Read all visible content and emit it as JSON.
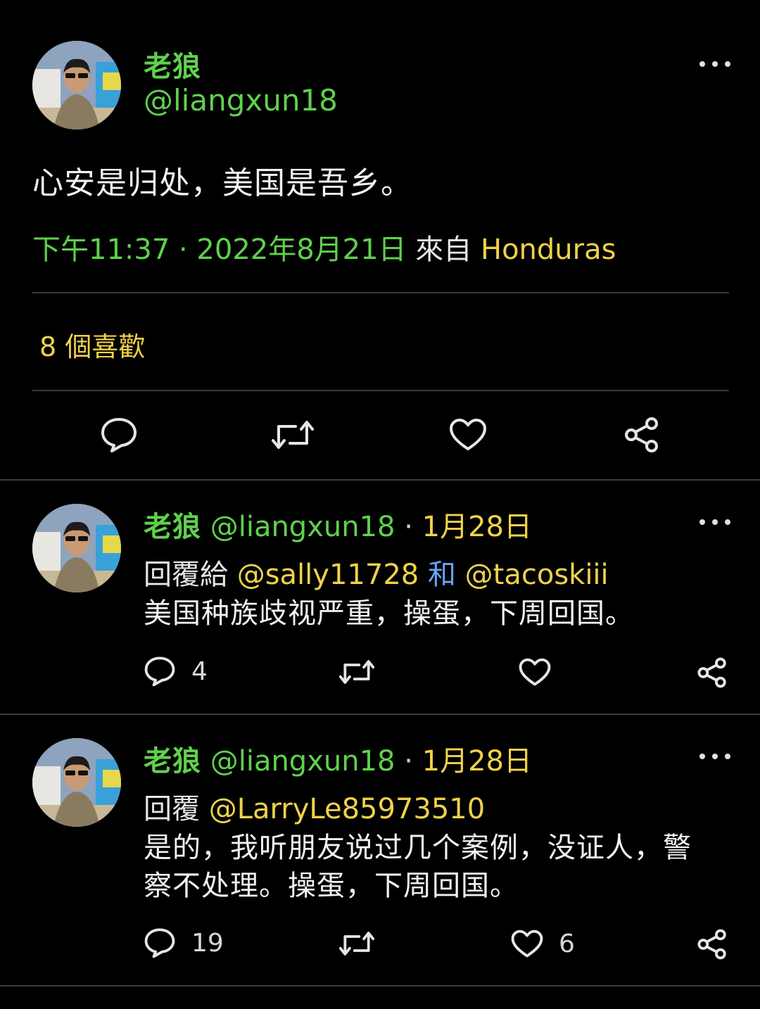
{
  "main_tweet": {
    "display_name": "老狼",
    "handle": "@liangxun18",
    "text": "心安是归处，美国是吾乡。",
    "time": "下午11:37 · 2022年8月21日",
    "source_prefix": "來自",
    "source_location": "Honduras",
    "likes_count": "8",
    "likes_label": "個喜歡",
    "icons": [
      "reply-icon",
      "retweet-icon",
      "like-icon",
      "share-icon",
      "more-icon"
    ]
  },
  "replies": [
    {
      "display_name": "老狼",
      "handle": "@liangxun18",
      "separator": "·",
      "date": "1月28日",
      "reply_label": "回覆給",
      "mention_1": "@sally11728",
      "conjunction": "和",
      "mention_2": "@tacoskiii",
      "text": "美国种族歧视严重，操蛋，下周回国。",
      "reply_count": "4",
      "retweet_count": "",
      "like_count": ""
    },
    {
      "display_name": "老狼",
      "handle": "@liangxun18",
      "separator": "·",
      "date": "1月28日",
      "reply_label": "回覆",
      "mention_1": "@LarryLe85973510",
      "text_line_1": "是的，我听朋友说过几个案例，没证人，警",
      "text_line_2": "察不处理。操蛋，下周回国。",
      "reply_count": "19",
      "retweet_count": "",
      "like_count": "6"
    }
  ],
  "colors": {
    "background": "#000000",
    "name_green": "#5fd14d",
    "highlight_yellow": "#f0d24a",
    "link_blue": "#6aa4ff",
    "divider": "#3a3a3a"
  }
}
